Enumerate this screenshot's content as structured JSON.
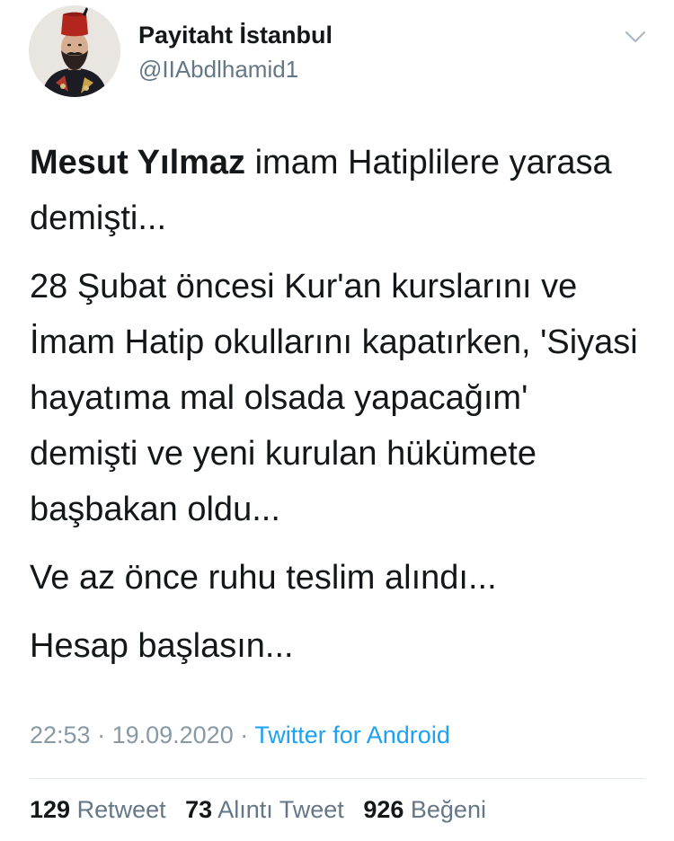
{
  "author": {
    "display_name": "Payitaht İstanbul",
    "handle": "@IIAbdlhamid1",
    "avatar_icon": "portrait-avatar"
  },
  "tweet": {
    "para1_bold": "Mesut Yılmaz",
    "para1_rest": " imam Hatiplilere yarasa demişti...",
    "para2": "28 Şubat öncesi Kur'an kurslarını ve İmam Hatip okullarını kapatırken, 'Siyasi hayatıma mal olsada yapacağım' demişti ve yeni kurulan hükümete başbakan oldu...",
    "para3": "Ve az önce ruhu teslim alındı...",
    "para4": "Hesap başlasın..."
  },
  "meta": {
    "time": "22:53",
    "separator1": " · ",
    "date": "19.09.2020",
    "separator2": " · ",
    "source": "Twitter for Android"
  },
  "stats": {
    "retweets": "129",
    "retweets_label": "Retweet",
    "quotes": "73",
    "quotes_label": "Alıntı Tweet",
    "likes": "926",
    "likes_label": "Beğeni"
  },
  "colors": {
    "text": "#14171a",
    "secondary": "#657786",
    "link": "#1da1f2",
    "divider": "#e1e8ed"
  }
}
